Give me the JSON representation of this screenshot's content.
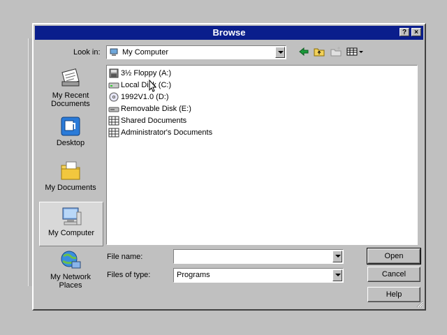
{
  "dialog": {
    "title": "Browse",
    "help_btn": "?",
    "close_btn": "×"
  },
  "lookin": {
    "label": "Look in:",
    "value": "My Computer"
  },
  "toolbar": {
    "icons": [
      "back-icon",
      "up-folder-icon",
      "new-folder-icon",
      "views-menu-icon"
    ]
  },
  "places": [
    {
      "label": "My Recent Documents",
      "icon": "recent-documents-icon"
    },
    {
      "label": "Desktop",
      "icon": "desktop-icon"
    },
    {
      "label": "My Documents",
      "icon": "my-documents-icon"
    },
    {
      "label": "My Computer",
      "icon": "my-computer-icon"
    },
    {
      "label": "My Network Places",
      "icon": "network-places-icon"
    }
  ],
  "files": [
    {
      "label": "3½ Floppy (A:)",
      "icon": "floppy-drive-icon"
    },
    {
      "label": "Local Disk (C:)",
      "icon": "hard-disk-icon"
    },
    {
      "label": "1992V1.0 (D:)",
      "icon": "cd-drive-icon"
    },
    {
      "label": "Removable Disk (E:)",
      "icon": "removable-disk-icon"
    },
    {
      "label": "Shared Documents",
      "icon": "shared-folder-icon"
    },
    {
      "label": "Administrator's Documents",
      "icon": "user-folder-icon"
    }
  ],
  "filename": {
    "label": "File name:",
    "value": ""
  },
  "filetype": {
    "label": "Files of type:",
    "value": "Programs"
  },
  "buttons": {
    "open": "Open",
    "cancel": "Cancel",
    "help": "Help"
  },
  "colors": {
    "titlebar": "#0a1e8c",
    "face": "#c0c0c0"
  }
}
